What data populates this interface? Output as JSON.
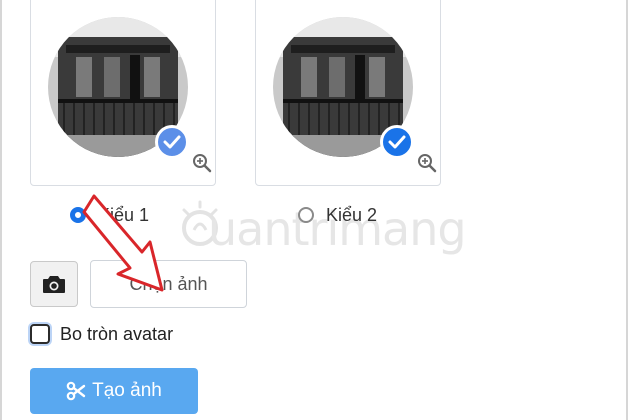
{
  "styles": [
    {
      "label": "Kiểu 1",
      "selected": true
    },
    {
      "label": "Kiểu 2",
      "selected": false
    }
  ],
  "upload": {
    "button_icon": "camera-icon",
    "pick_label": "Chọn ảnh"
  },
  "options": {
    "round_avatar_label": "Bo tròn avatar",
    "round_avatar_checked": false
  },
  "actions": {
    "create_label": "Tạo ảnh",
    "create_icon": "scissors-icon"
  },
  "watermark": {
    "text": "uantrimang"
  },
  "colors": {
    "accent": "#1a73e8",
    "button": "#59a8f0",
    "check_badge_1": "#5c8fe8",
    "check_badge_2": "#1a73e8"
  }
}
